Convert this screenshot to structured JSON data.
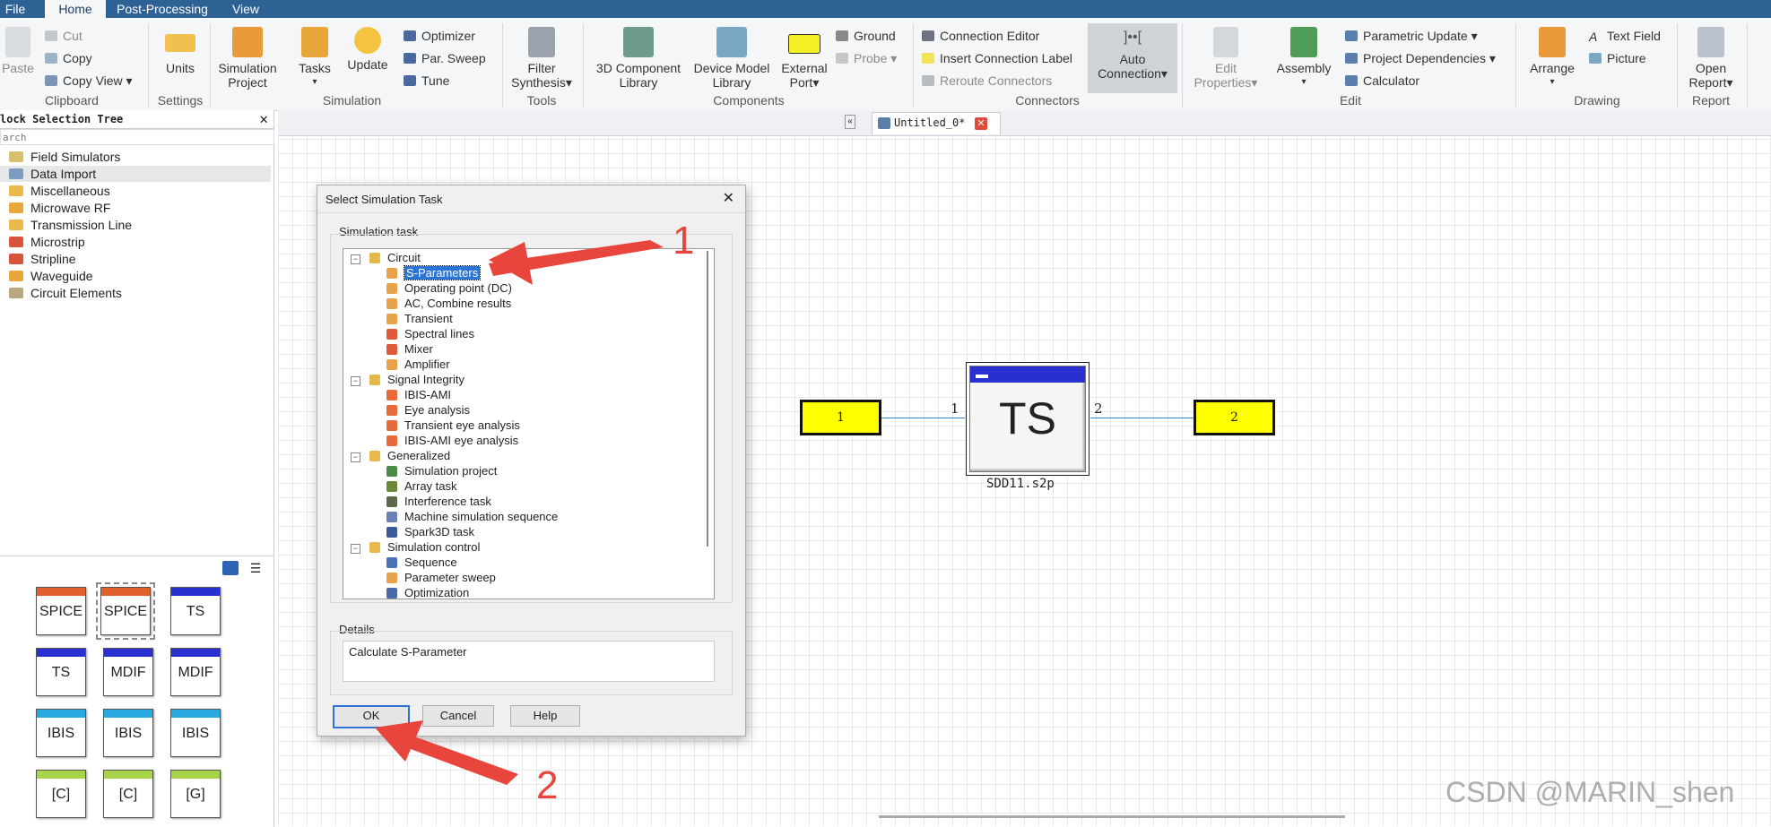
{
  "menu": [
    "File",
    "Home",
    "Post-Processing",
    "View"
  ],
  "ribbon": {
    "clipboard": {
      "paste": "Paste",
      "cut": "Cut",
      "copy": "Copy",
      "copy_view": "Copy View",
      "label": "Clipboard"
    },
    "settings": {
      "units": "Units",
      "label": "Settings"
    },
    "simulation": {
      "sim_project_1": "Simulation",
      "sim_project_2": "Project",
      "tasks": "Tasks",
      "update": "Update",
      "optimizer": "Optimizer",
      "par_sweep": "Par. Sweep",
      "tune": "Tune",
      "label": "Simulation"
    },
    "tools": {
      "filter_1": "Filter",
      "filter_2": "Synthesis",
      "label": "Tools"
    },
    "components": {
      "lib3d_1": "3D Component",
      "lib3d_2": "Library",
      "devmodel_1": "Device Model",
      "devmodel_2": "Library",
      "ext_port_1": "External",
      "ext_port_2": "Port",
      "ground": "Ground",
      "probe": "Probe",
      "label": "Components"
    },
    "connectors": {
      "conn_editor": "Connection Editor",
      "insert_label": "Insert Connection Label",
      "reroute": "Reroute Connectors",
      "auto_1": "Auto",
      "auto_2": "Connection",
      "label": "Connectors"
    },
    "edit": {
      "props_1": "Edit",
      "props_2": "Properties",
      "assembly": "Assembly",
      "param_update": "Parametric Update",
      "project_deps": "Project Dependencies",
      "calculator": "Calculator",
      "label": "Edit"
    },
    "drawing": {
      "arrange": "Arrange",
      "text_field": "Text Field",
      "picture": "Picture",
      "label": "Drawing"
    },
    "report": {
      "open_1": "Open",
      "open_2": "Report",
      "label": "Report"
    }
  },
  "tree_panel": {
    "title": "lock Selection Tree",
    "search_placeholder": "arch",
    "items": [
      "Field Simulators",
      "Data Import",
      "Miscellaneous",
      "Microwave RF",
      "Transmission Line",
      "Microstrip",
      "Stripline",
      "Waveguide",
      "Circuit Elements"
    ]
  },
  "palette": [
    "SPICE",
    "SPICE",
    "TS",
    "TS",
    "MDIF",
    "MDIF",
    "IBIS",
    "IBIS",
    "IBIS",
    "[C]",
    "[C]",
    "[G]"
  ],
  "doc_tab": "Untitled_0*",
  "schematic": {
    "port1": "1",
    "port2": "2",
    "pin1": "1",
    "pin2": "2",
    "block_label": "TS",
    "block_file": "SDD11.s2p"
  },
  "dialog": {
    "title": "Select Simulation Task",
    "group_label": "Simulation task",
    "categories": [
      {
        "name": "Circuit",
        "items": [
          "S-Parameters",
          "Operating point (DC)",
          "AC, Combine results",
          "Transient",
          "Spectral lines",
          "Mixer",
          "Amplifier"
        ]
      },
      {
        "name": "Signal Integrity",
        "items": [
          "IBIS-AMI",
          "Eye analysis",
          "Transient eye analysis",
          "IBIS-AMI eye analysis"
        ]
      },
      {
        "name": "Generalized",
        "items": [
          "Simulation project",
          "Array task",
          "Interference task",
          "Machine simulation sequence",
          "Spark3D task"
        ]
      },
      {
        "name": "Simulation control",
        "items": [
          "Sequence",
          "Parameter sweep",
          "Optimization"
        ]
      }
    ],
    "details_label": "Details",
    "details_text": "Calculate S-Parameter",
    "ok": "OK",
    "cancel": "Cancel",
    "help": "Help"
  },
  "annotations": {
    "num1": "1",
    "num2": "2"
  },
  "watermark": "CSDN @MARIN_shen",
  "colors": {
    "menubar": "#2f6294",
    "port_fill": "#ffff00",
    "ts_bar": "#2a2fd0",
    "arrow": "#e8453c"
  }
}
